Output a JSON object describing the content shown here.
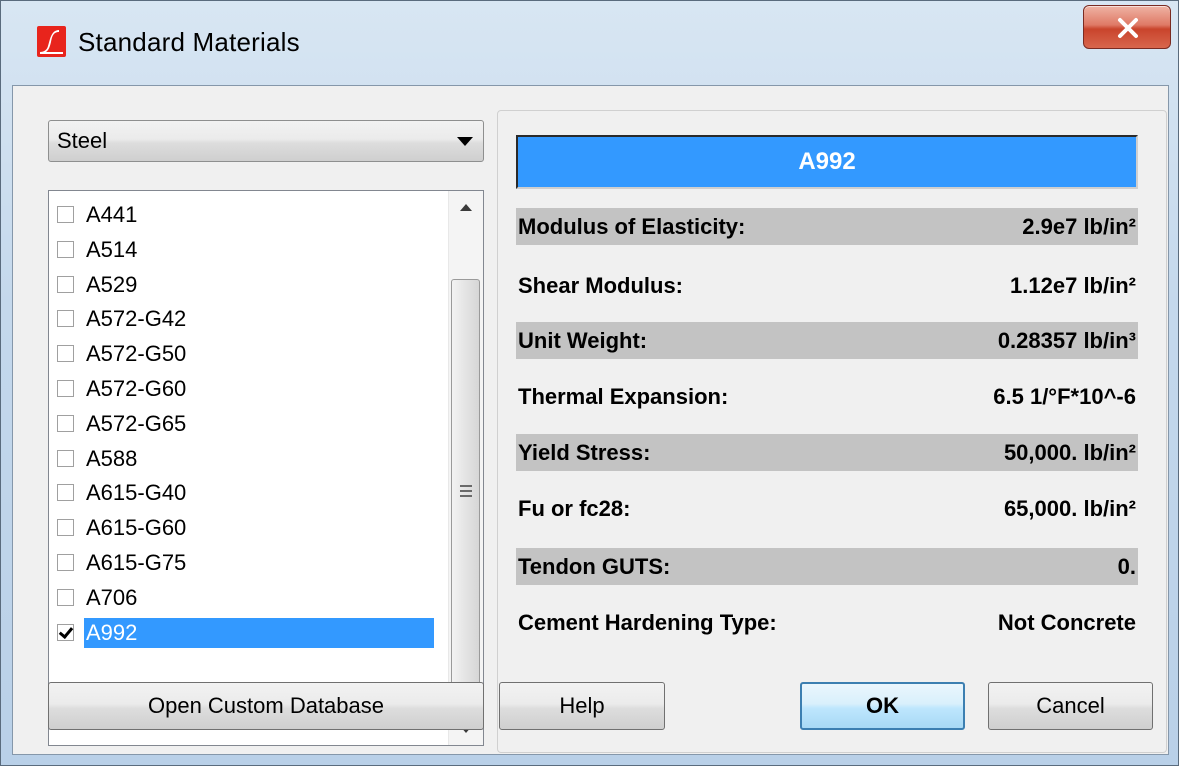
{
  "window": {
    "title": "Standard Materials",
    "close_label": "X"
  },
  "category": {
    "selected": "Steel"
  },
  "materials": {
    "items": [
      {
        "label": "A441",
        "checked": false
      },
      {
        "label": "A514",
        "checked": false
      },
      {
        "label": "A529",
        "checked": false
      },
      {
        "label": "A572-G42",
        "checked": false
      },
      {
        "label": "A572-G50",
        "checked": false
      },
      {
        "label": "A572-G60",
        "checked": false
      },
      {
        "label": "A572-G65",
        "checked": false
      },
      {
        "label": "A588",
        "checked": false
      },
      {
        "label": "A615-G40",
        "checked": false
      },
      {
        "label": "A615-G60",
        "checked": false
      },
      {
        "label": "A615-G75",
        "checked": false
      },
      {
        "label": "A706",
        "checked": false
      },
      {
        "label": "A992",
        "checked": true,
        "selected": true
      }
    ]
  },
  "properties": {
    "material_name": "A992",
    "rows": [
      {
        "label": "Modulus of Elasticity:",
        "value": "2.9e7 lb/in²",
        "shaded": true
      },
      {
        "label": "Shear Modulus:",
        "value": "1.12e7 lb/in²",
        "shaded": false
      },
      {
        "label": "Unit Weight:",
        "value": "0.28357 lb/in³",
        "shaded": true
      },
      {
        "label": "Thermal Expansion:",
        "value": "6.5 1/°F*10^-6",
        "shaded": false
      },
      {
        "label": "Yield Stress:",
        "value": "50,000. lb/in²",
        "shaded": true
      },
      {
        "label": "Fu or fc28:",
        "value": "65,000. lb/in²",
        "shaded": false
      },
      {
        "label": "Tendon GUTS:",
        "value": "0.",
        "shaded": true
      },
      {
        "label": "Cement Hardening Type:",
        "value": "Not Concrete",
        "shaded": false
      }
    ]
  },
  "buttons": {
    "open_custom_db": "Open Custom Database",
    "help": "Help",
    "ok": "OK",
    "cancel": "Cancel"
  },
  "colors": {
    "selection": "#3399ff",
    "shaded_row": "#c3c3c3"
  }
}
